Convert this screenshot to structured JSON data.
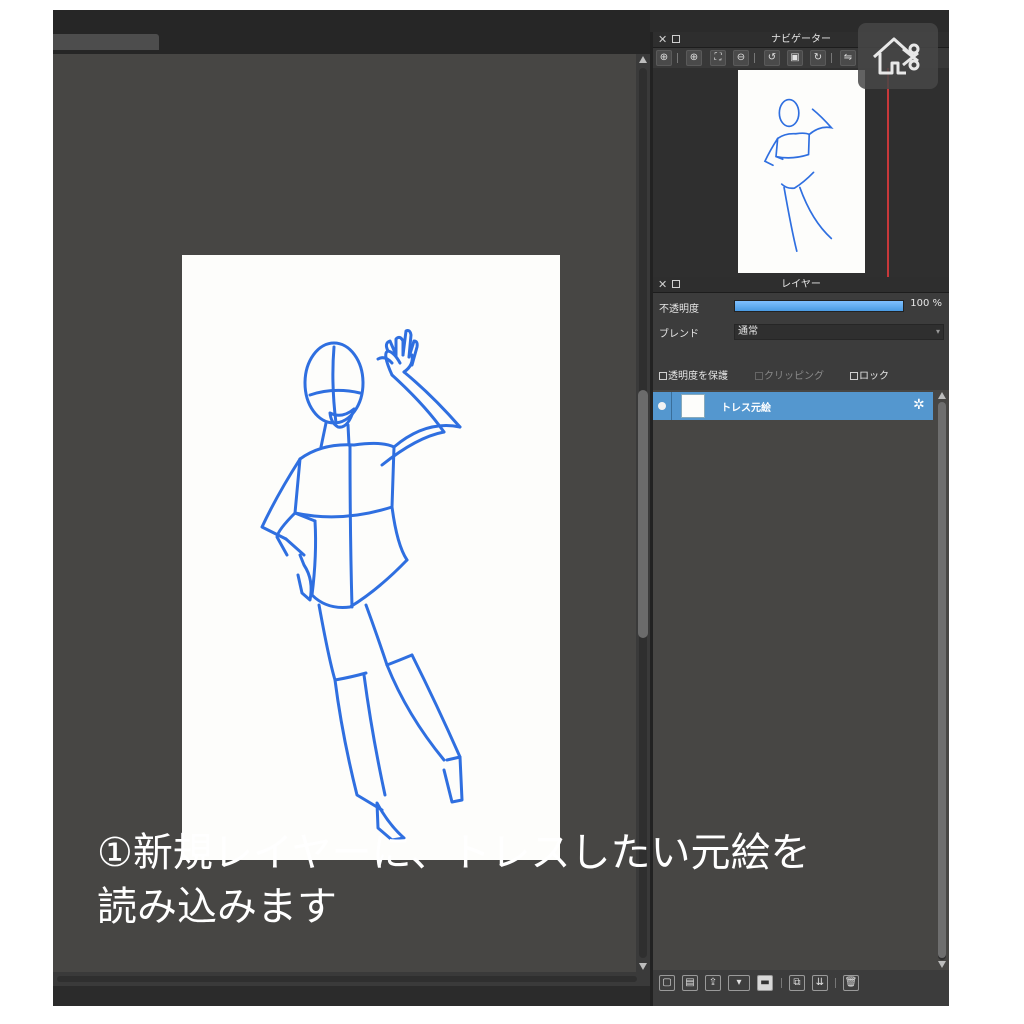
{
  "navigator": {
    "title": "ナビゲーター",
    "close_icon": "close-icon",
    "toolbar_icons": [
      "zoom-in-icon",
      "zoom-in-icon",
      "fit-screen-icon",
      "zoom-out-icon",
      "rotate-left-icon",
      "reset-icon",
      "rotate-right-icon",
      "flip-icon"
    ]
  },
  "layers": {
    "title": "レイヤー",
    "opacity_label": "不透明度",
    "opacity_value": "100 %",
    "opacity_percent": 100,
    "blend_label": "ブレンド",
    "blend_value": "通常",
    "protect_alpha": "透明度を保護",
    "clipping": "クリッピング",
    "lock": "ロック",
    "items": [
      {
        "name": "トレス元絵",
        "selected": true,
        "visible": true
      }
    ],
    "toolbar_icons": [
      "new-layer-icon",
      "new-layer-icon",
      "import-icon",
      "add-layer-dropdown-icon",
      "folder-icon",
      "duplicate-icon",
      "merge-icon",
      "trash-icon"
    ]
  },
  "caption": {
    "line1": "①新規レイヤーに、トレスしたい元絵を",
    "line2": "読み込みます"
  },
  "colors": {
    "selected_layer": "#5497cf",
    "sketch_stroke": "#2f6fe0",
    "canvas_bg": "#474644"
  }
}
